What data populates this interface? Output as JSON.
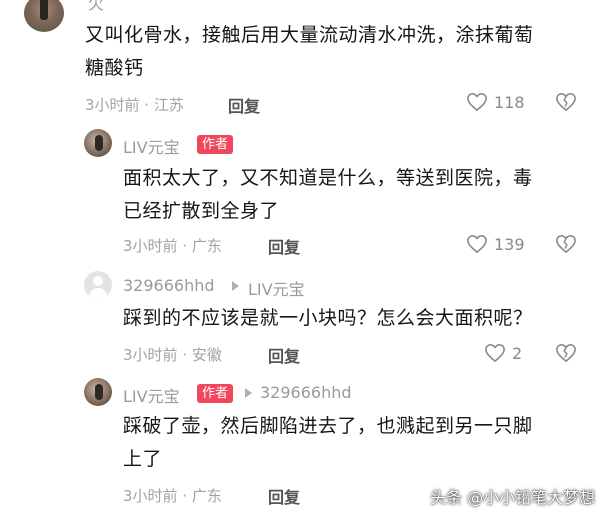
{
  "top_comment": {
    "name": "欠",
    "text_line1": "又叫化骨水，接触后用大量流动清水冲洗，涂抹葡萄",
    "text_line2": "糖酸钙",
    "meta": "3小时前 · 江苏",
    "reply_label": "回复",
    "likes": "118"
  },
  "replies": [
    {
      "user": "LIV元宝",
      "badge": "作者",
      "text_line1": "面积太大了，又不知道是什么，等送到医院，毒",
      "text_line2": "已经扩散到全身了",
      "meta": "3小时前 · 广东",
      "reply_label": "回复",
      "likes": "139"
    },
    {
      "user": "329666hhd",
      "reply_to": "LIV元宝",
      "text_line1": "踩到的不应该是就一小块吗？怎么会大面积呢？",
      "meta": "3小时前 · 安徽",
      "reply_label": "回复",
      "likes": "2"
    },
    {
      "user": "LIV元宝",
      "badge": "作者",
      "reply_to": "329666hhd",
      "text_line1": "踩破了壶，然后脚陷进去了，也溅起到另一只脚",
      "text_line2": "上了",
      "meta": "3小时前 · 广东",
      "reply_label": "回复"
    }
  ],
  "watermark": "头条 @小小铅笔大梦想",
  "colors": {
    "author_badge": "#f0475c",
    "meta_text": "#a3a3a3",
    "body_text": "#161616"
  },
  "icons": {
    "like": "heart-outline-icon",
    "dislike": "broken-heart-icon",
    "reply_arrow": "play-triangle-icon"
  }
}
